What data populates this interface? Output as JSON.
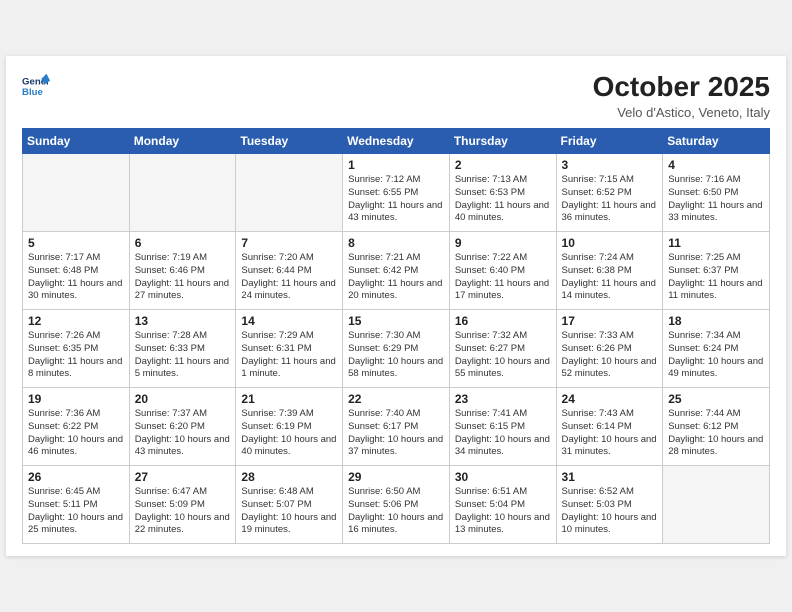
{
  "header": {
    "logo_line1": "General",
    "logo_line2": "Blue",
    "month": "October 2025",
    "location": "Velo d'Astico, Veneto, Italy"
  },
  "weekdays": [
    "Sunday",
    "Monday",
    "Tuesday",
    "Wednesday",
    "Thursday",
    "Friday",
    "Saturday"
  ],
  "weeks": [
    [
      {
        "day": "",
        "empty": true
      },
      {
        "day": "",
        "empty": true
      },
      {
        "day": "",
        "empty": true
      },
      {
        "day": "1",
        "sunrise": "7:12 AM",
        "sunset": "6:55 PM",
        "daylight": "11 hours and 43 minutes."
      },
      {
        "day": "2",
        "sunrise": "7:13 AM",
        "sunset": "6:53 PM",
        "daylight": "11 hours and 40 minutes."
      },
      {
        "day": "3",
        "sunrise": "7:15 AM",
        "sunset": "6:52 PM",
        "daylight": "11 hours and 36 minutes."
      },
      {
        "day": "4",
        "sunrise": "7:16 AM",
        "sunset": "6:50 PM",
        "daylight": "11 hours and 33 minutes."
      }
    ],
    [
      {
        "day": "5",
        "sunrise": "7:17 AM",
        "sunset": "6:48 PM",
        "daylight": "11 hours and 30 minutes."
      },
      {
        "day": "6",
        "sunrise": "7:19 AM",
        "sunset": "6:46 PM",
        "daylight": "11 hours and 27 minutes."
      },
      {
        "day": "7",
        "sunrise": "7:20 AM",
        "sunset": "6:44 PM",
        "daylight": "11 hours and 24 minutes."
      },
      {
        "day": "8",
        "sunrise": "7:21 AM",
        "sunset": "6:42 PM",
        "daylight": "11 hours and 20 minutes."
      },
      {
        "day": "9",
        "sunrise": "7:22 AM",
        "sunset": "6:40 PM",
        "daylight": "11 hours and 17 minutes."
      },
      {
        "day": "10",
        "sunrise": "7:24 AM",
        "sunset": "6:38 PM",
        "daylight": "11 hours and 14 minutes."
      },
      {
        "day": "11",
        "sunrise": "7:25 AM",
        "sunset": "6:37 PM",
        "daylight": "11 hours and 11 minutes."
      }
    ],
    [
      {
        "day": "12",
        "sunrise": "7:26 AM",
        "sunset": "6:35 PM",
        "daylight": "11 hours and 8 minutes."
      },
      {
        "day": "13",
        "sunrise": "7:28 AM",
        "sunset": "6:33 PM",
        "daylight": "11 hours and 5 minutes."
      },
      {
        "day": "14",
        "sunrise": "7:29 AM",
        "sunset": "6:31 PM",
        "daylight": "11 hours and 1 minute."
      },
      {
        "day": "15",
        "sunrise": "7:30 AM",
        "sunset": "6:29 PM",
        "daylight": "10 hours and 58 minutes."
      },
      {
        "day": "16",
        "sunrise": "7:32 AM",
        "sunset": "6:27 PM",
        "daylight": "10 hours and 55 minutes."
      },
      {
        "day": "17",
        "sunrise": "7:33 AM",
        "sunset": "6:26 PM",
        "daylight": "10 hours and 52 minutes."
      },
      {
        "day": "18",
        "sunrise": "7:34 AM",
        "sunset": "6:24 PM",
        "daylight": "10 hours and 49 minutes."
      }
    ],
    [
      {
        "day": "19",
        "sunrise": "7:36 AM",
        "sunset": "6:22 PM",
        "daylight": "10 hours and 46 minutes."
      },
      {
        "day": "20",
        "sunrise": "7:37 AM",
        "sunset": "6:20 PM",
        "daylight": "10 hours and 43 minutes."
      },
      {
        "day": "21",
        "sunrise": "7:39 AM",
        "sunset": "6:19 PM",
        "daylight": "10 hours and 40 minutes."
      },
      {
        "day": "22",
        "sunrise": "7:40 AM",
        "sunset": "6:17 PM",
        "daylight": "10 hours and 37 minutes."
      },
      {
        "day": "23",
        "sunrise": "7:41 AM",
        "sunset": "6:15 PM",
        "daylight": "10 hours and 34 minutes."
      },
      {
        "day": "24",
        "sunrise": "7:43 AM",
        "sunset": "6:14 PM",
        "daylight": "10 hours and 31 minutes."
      },
      {
        "day": "25",
        "sunrise": "7:44 AM",
        "sunset": "6:12 PM",
        "daylight": "10 hours and 28 minutes."
      }
    ],
    [
      {
        "day": "26",
        "sunrise": "6:45 AM",
        "sunset": "5:11 PM",
        "daylight": "10 hours and 25 minutes."
      },
      {
        "day": "27",
        "sunrise": "6:47 AM",
        "sunset": "5:09 PM",
        "daylight": "10 hours and 22 minutes."
      },
      {
        "day": "28",
        "sunrise": "6:48 AM",
        "sunset": "5:07 PM",
        "daylight": "10 hours and 19 minutes."
      },
      {
        "day": "29",
        "sunrise": "6:50 AM",
        "sunset": "5:06 PM",
        "daylight": "10 hours and 16 minutes."
      },
      {
        "day": "30",
        "sunrise": "6:51 AM",
        "sunset": "5:04 PM",
        "daylight": "10 hours and 13 minutes."
      },
      {
        "day": "31",
        "sunrise": "6:52 AM",
        "sunset": "5:03 PM",
        "daylight": "10 hours and 10 minutes."
      },
      {
        "day": "",
        "empty": true
      }
    ]
  ]
}
